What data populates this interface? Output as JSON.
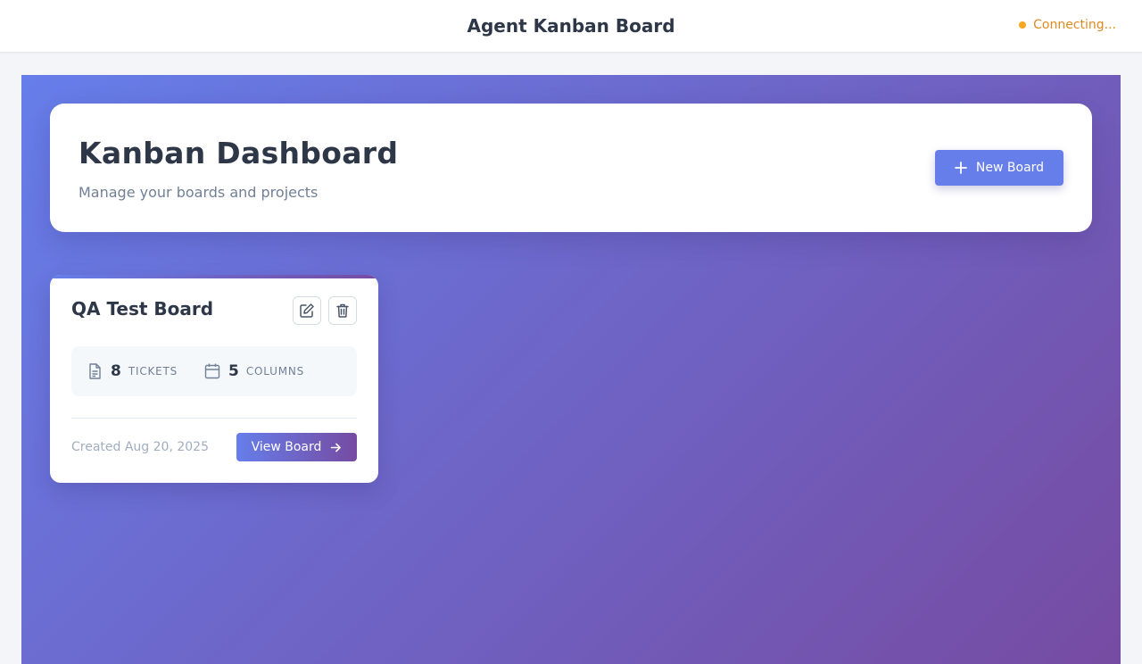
{
  "topbar": {
    "title": "Agent Kanban Board",
    "status_text": "Connecting...",
    "status_color": "#f5a623"
  },
  "dashboard": {
    "title": "Kanban Dashboard",
    "subtitle": "Manage your boards and projects",
    "new_board_label": "New Board",
    "new_board_icon": "plus-icon"
  },
  "boards": [
    {
      "name": "QA Test Board",
      "edit_icon": "edit-icon",
      "delete_icon": "trash-icon",
      "tickets_count": "8",
      "tickets_label": "TICKETS",
      "tickets_icon": "document-icon",
      "columns_count": "5",
      "columns_label": "COLUMNS",
      "columns_icon": "calendar-icon",
      "created": "Created Aug 20, 2025",
      "view_label": "View Board",
      "view_icon": "arrow-right-icon"
    }
  ],
  "colors": {
    "accent": "#667eea",
    "gradient_end": "#764ba2"
  }
}
